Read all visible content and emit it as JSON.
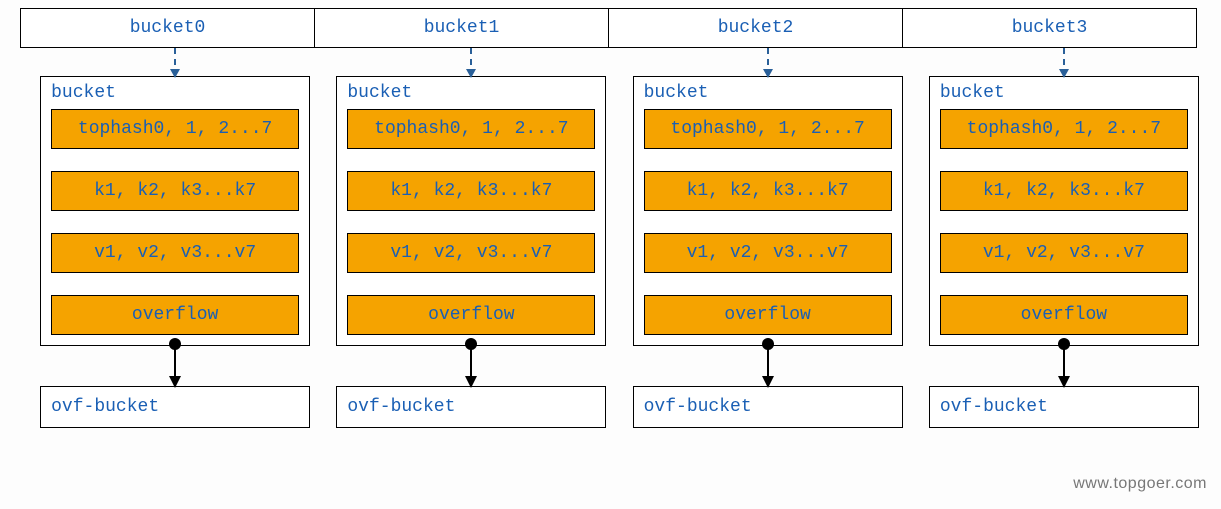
{
  "headers": [
    "bucket0",
    "bucket1",
    "bucket2",
    "bucket3"
  ],
  "bucket": {
    "title": "bucket",
    "tophash": "tophash0, 1, 2...7",
    "keys": "k1, k2, k3...k7",
    "vals": "v1, v2, v3...v7",
    "overflow": "overflow"
  },
  "ovf": "ovf-bucket",
  "watermark": "www.topgoer.com"
}
